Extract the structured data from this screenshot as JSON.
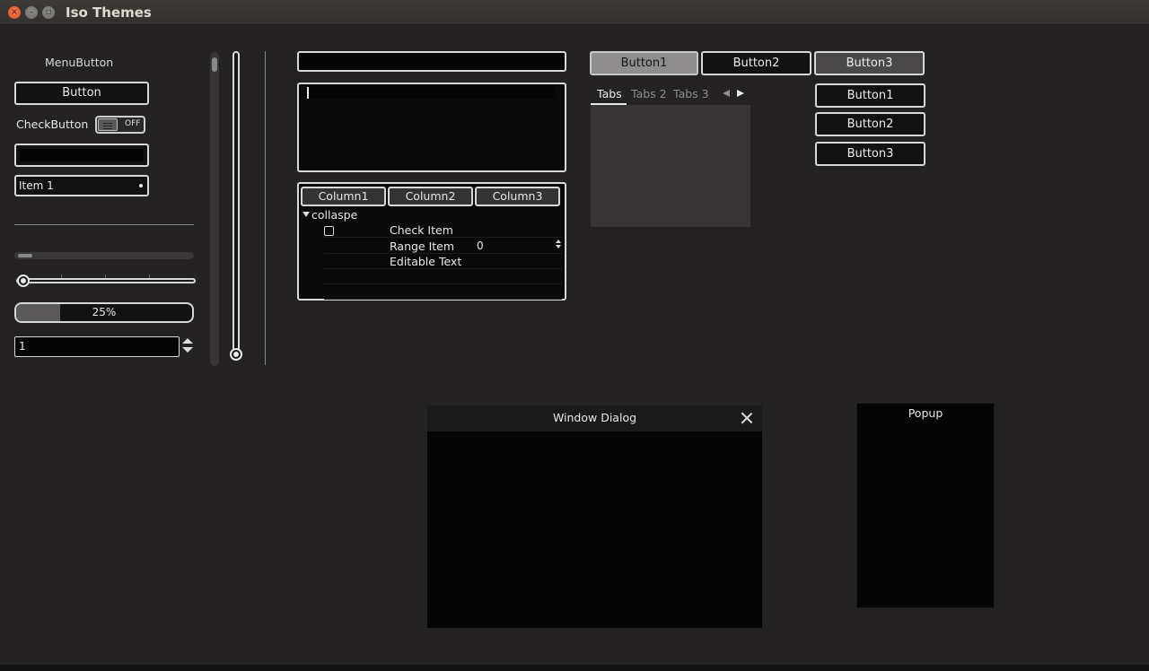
{
  "window": {
    "title": "Iso Themes"
  },
  "left": {
    "menubutton": "MenuButton",
    "button": "Button",
    "checkbutton_label": "CheckButton",
    "toggle_state": "OFF",
    "combo_value": "Item 1",
    "progress": {
      "value": 0.25,
      "label": "25%"
    },
    "spin_value": "1"
  },
  "tree": {
    "columns": [
      "Column1",
      "Column2",
      "Column3"
    ],
    "group": "collaspe",
    "items": {
      "check": "Check Item",
      "range": "Range Item",
      "range_value": "0",
      "editable": "Editable Text"
    }
  },
  "hbuttons": [
    "Button1",
    "Button2",
    "Button3"
  ],
  "tabs": [
    "Tabs",
    "Tabs 2",
    "Tabs 3"
  ],
  "vbuttons": [
    "Button1",
    "Button2",
    "Button3"
  ],
  "dialog": {
    "title": "Window Dialog"
  },
  "popup": {
    "title": "Popup"
  }
}
